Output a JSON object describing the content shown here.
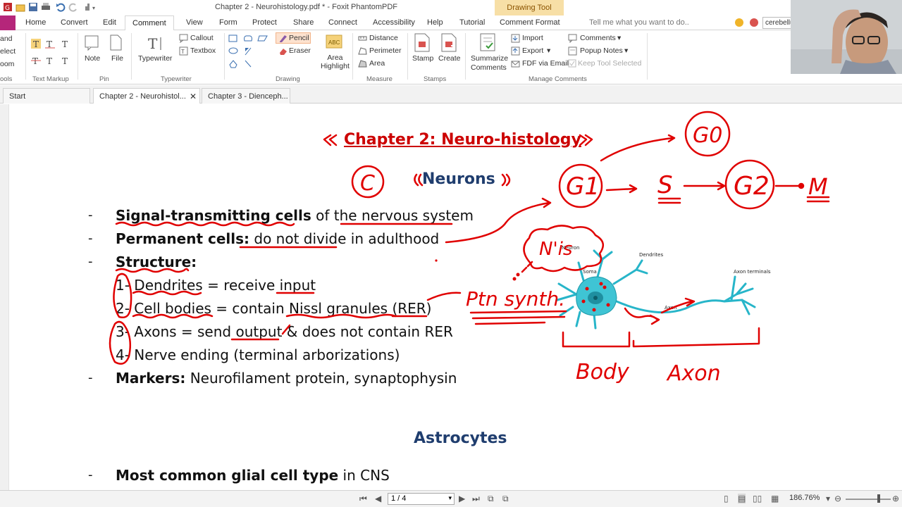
{
  "window": {
    "title": "Chapter 2 - Neurohistology.pdf * - Foxit PhantomPDF",
    "contextual_tab": "Drawing Tool"
  },
  "ribbon_tabs": [
    "Home",
    "Convert",
    "Edit",
    "Comment",
    "View",
    "Form",
    "Protect",
    "Share",
    "Connect",
    "Accessibility",
    "Help",
    "Tutorial",
    "Comment Format"
  ],
  "active_tab": "Comment",
  "tell_me": "Tell me what you want to do..",
  "search_value": "cerebellu",
  "ribbon": {
    "left_cut": [
      "and",
      "elect",
      "oom",
      "ools"
    ],
    "text_markup": "Text Markup",
    "pin": {
      "note": "Note",
      "file": "File",
      "label": "Pin"
    },
    "typewriter": {
      "typewriter": "Typewriter",
      "callout": "Callout",
      "textbox": "Textbox",
      "label": "Typewriter"
    },
    "drawing": {
      "pencil": "Pencil",
      "eraser": "Eraser",
      "area_highlight": "Area\nHighlight",
      "label": "Drawing"
    },
    "measure": {
      "distance": "Distance",
      "perimeter": "Perimeter",
      "area": "Area",
      "label": "Measure"
    },
    "stamps": {
      "stamp": "Stamp",
      "create": "Create",
      "label": "Stamps"
    },
    "manage": {
      "summarize": "Summarize\nComments",
      "import": "Import",
      "export": "Export",
      "fdf": "FDF via Email",
      "comments": "Comments",
      "popup_notes": "Popup Notes",
      "keep_tool": "Keep Tool Selected",
      "label": "Manage Comments"
    }
  },
  "doc_tabs": [
    "Start",
    "Chapter 2 - Neurohistol...",
    "Chapter 3 - Dienceph..."
  ],
  "page": {
    "title": "Chapter 2: Neuro-histology",
    "neurons_heading": "Neurons",
    "lines": [
      {
        "bold": "Signal-transmitting cells",
        "rest": " of the nervous system"
      },
      {
        "bold": "Permanent cells:",
        "rest": " do not divide in adulthood"
      },
      {
        "bold": "Structure:",
        "rest": ""
      },
      {
        "bold": "",
        "rest": "1- Dendrites = receive input"
      },
      {
        "bold": "",
        "rest": "2- Cell bodies = contain Nissl granules (RER)"
      },
      {
        "bold": "",
        "rest": "3- Axons = send output & does not contain RER"
      },
      {
        "bold": "",
        "rest": "4- Nerve ending (terminal arborizations)"
      },
      {
        "bold": "Markers:",
        "rest": " Neurofilament protein, synaptophysin"
      }
    ],
    "astro_heading": "Astrocytes",
    "astro_line": {
      "bold": "Most common glial cell type",
      "rest": " in CNS"
    },
    "figure_labels": {
      "neuron": "Neuron",
      "dendrites": "Dendrites",
      "soma": "Soma",
      "axon": "Axon",
      "axon_terminals": "Axon terminals"
    }
  },
  "annotations": {
    "c": "C",
    "g0": "G0",
    "g1": "G1",
    "s": "S",
    "g2": "G2",
    "m": "M",
    "nis": "N'is",
    "ptn": "Ptn synth.",
    "body": "Body",
    "axon": "Axon",
    "ink_color": "#e00000"
  },
  "status": {
    "page": "1 / 4",
    "zoom": "186.76%"
  },
  "colors": {
    "file_tab": "#b5267a",
    "drawing_tool_bg": "#f7dfa6",
    "heading_red": "#c00000",
    "heading_blue": "#1f3d6e",
    "neuron_cyan": "#27b5c9"
  }
}
